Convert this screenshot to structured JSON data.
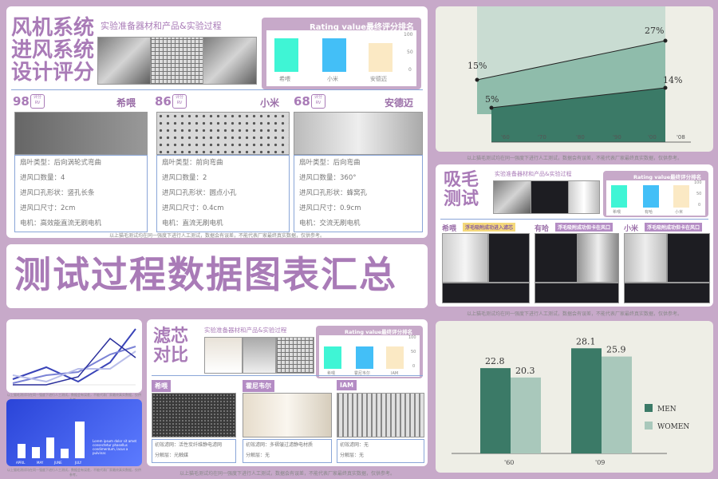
{
  "fan": {
    "title_lines": [
      "风机系统",
      "进风系统",
      "设计评分"
    ],
    "subtitle": "实验准备器材和产品&实验过程",
    "rating_title": "Rating value最终评分排名",
    "rating_bars": [
      {
        "label": "希喂",
        "value": 35,
        "color": "#3ff5d5"
      },
      {
        "label": "小米",
        "value": 35,
        "color": "#43bff7"
      },
      {
        "label": "安德迈",
        "value": 30,
        "color": "#fbe9c4"
      }
    ],
    "rating_ticks": [
      "100",
      "50",
      "0"
    ],
    "products": [
      {
        "score": "98",
        "rv": "评分 RV",
        "name": "希喂",
        "specs": [
          "扇叶类型：后向涡轮式弯曲",
          "进风口数量：4",
          "进风口孔形状：竖孔长条",
          "进风口尺寸：2cm",
          "电机：高效能直流无刷电机"
        ]
      },
      {
        "score": "86",
        "rv": "评分 RV",
        "name": "小米",
        "specs": [
          "扇叶类型：前向弯曲",
          "进风口数量：2",
          "进风口孔形状：圆点小孔",
          "进风口尺寸：0.4cm",
          "电机：直流无刷电机"
        ]
      },
      {
        "score": "68",
        "rv": "评分 RV",
        "name": "安德迈",
        "specs": [
          "扇叶类型：后向弯曲",
          "进风口数量：360°",
          "进风口孔形状：蜂窝孔",
          "进风口尺寸：0.9cm",
          "电机：交流无刷电机"
        ]
      }
    ],
    "footnote": "以上猫毛测试均在同一强度下进行人工测试，数据会有误差，不能代表厂家最终真实数据，仅供参考。"
  },
  "area_chart": {
    "labels": [
      "15%",
      "27%",
      "5%",
      "14%"
    ],
    "x_ticks": [
      "'60",
      "'70",
      "'80",
      "'90",
      "'00",
      "'08"
    ],
    "footnote": "以上猫毛测试均在同一强度下进行人工测试，数据会有误差，不能代表厂家最终真实数据，仅供参考。"
  },
  "hair": {
    "title_lines": [
      "吸毛",
      "测试"
    ],
    "subtitle": "实验准备器材和产品&实验过程",
    "rating_title": "Rating value最终评分排名",
    "rating_bars": [
      {
        "label": "希喂",
        "value": 30,
        "color": "#3ff5d5"
      },
      {
        "label": "有哈",
        "value": 25,
        "color": "#43bff7"
      },
      {
        "label": "小米",
        "value": 22,
        "color": "#fbe9c4"
      }
    ],
    "rating_ticks": [
      "100",
      "50",
      "0"
    ],
    "products": [
      {
        "name": "希喂",
        "note": "浮毛吸附成功进入滤芯"
      },
      {
        "name": "有哈",
        "note": "浮毛吸附成功但卡在风口"
      },
      {
        "name": "小米",
        "note": "浮毛吸附成功但卡在风口"
      }
    ],
    "footnote": "以上猫毛测试均在同一强度下进行人工测试，数据会有误差，不能代表厂家最终真实数据，仅供参考。"
  },
  "banner": {
    "text": "测试过程数据图表汇总"
  },
  "filter": {
    "title_lines": [
      "滤芯",
      "对比"
    ],
    "subtitle": "实验准备器材和产品&实验过程",
    "rating_title": "Rating value最终评分排名",
    "rating_bars": [
      {
        "label": "希喂",
        "value": 45,
        "color": "#3ff5d5"
      },
      {
        "label": "霍尼韦尔",
        "value": 45,
        "color": "#43bff7"
      },
      {
        "label": "IAM",
        "value": 45,
        "color": "#fbe9c4"
      }
    ],
    "rating_ticks": [
      "100",
      "50",
      "0"
    ],
    "products": [
      {
        "name": "希喂",
        "specs": [
          "初效滤网：活性炭纤维静电滤网",
          "分解层：光触媒"
        ]
      },
      {
        "name": "霍尼韦尔",
        "specs": [
          "初效滤网：多褶皱过滤静电材质",
          "分解层：无"
        ]
      },
      {
        "name": "IAM",
        "specs": [
          "初效滤网：无",
          "分解层：无"
        ]
      }
    ],
    "footnote": "以上猫毛测试均在同一强度下进行人工测试，数据会有误差，不能代表厂家最终真实数据，仅供参考。"
  },
  "line_chart": {
    "footnote": "以上猫毛测试均在同一强度下进行人工测试，数据会有误差，不能代表厂家最终真实数据，仅供参考。"
  },
  "blue_chart": {
    "months": [
      "APRIL",
      "MAY",
      "JUNE",
      "JULY"
    ],
    "text_block": "Lorem ipsum dolor sit amet consectetur phasellus condimentum, lacus a pulvinar.",
    "footnote": "以上猫毛测试均在同一强度下进行人工测试，数据会有误差，不能代表厂家最终真实数据，仅供参考。"
  },
  "chart_data": [
    {
      "type": "bar",
      "categories": [
        "'60",
        "'09"
      ],
      "series": [
        {
          "name": "MEN",
          "values": [
            22.8,
            28.1
          ],
          "color": "#3b7a67"
        },
        {
          "name": "WOMEN",
          "values": [
            20.3,
            25.9
          ],
          "color": "#a9c8bb"
        }
      ],
      "ylim": [
        0,
        32
      ]
    }
  ]
}
